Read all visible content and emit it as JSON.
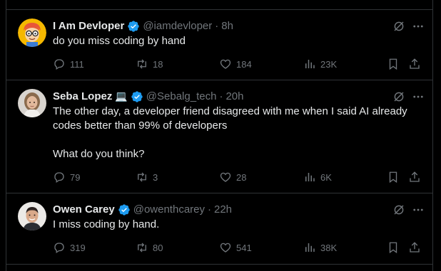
{
  "colors": {
    "background": "#000000",
    "text": "#e7e9ea",
    "muted": "#71767b",
    "verified": "#1d9bf0",
    "border": "#2f3336"
  },
  "tweets": [
    {
      "name": "I Am Devloper",
      "emoji": "",
      "handle": "@iamdevloper",
      "dot": "·",
      "time": "8h",
      "text": "do you miss coding by hand",
      "replies": "111",
      "retweets": "18",
      "likes": "184",
      "views": "23K",
      "avatar_icon": "cartoon-developer-avatar"
    },
    {
      "name": "Seba Lopez",
      "emoji": "💻",
      "handle": "@Sebalg_tech",
      "dot": "·",
      "time": "20h",
      "text": "The other day, a developer friend disagreed with me when I said AI already codes better than 99% of developers\n\nWhat do you think?",
      "replies": "79",
      "retweets": "3",
      "likes": "28",
      "views": "6K",
      "avatar_icon": "photo-avatar"
    },
    {
      "name": "Owen Carey",
      "emoji": "",
      "handle": "@owenthcarey",
      "dot": "·",
      "time": "22h",
      "text": "I miss coding by hand.",
      "replies": "319",
      "retweets": "80",
      "likes": "541",
      "views": "38K",
      "avatar_icon": "photo-avatar"
    }
  ]
}
